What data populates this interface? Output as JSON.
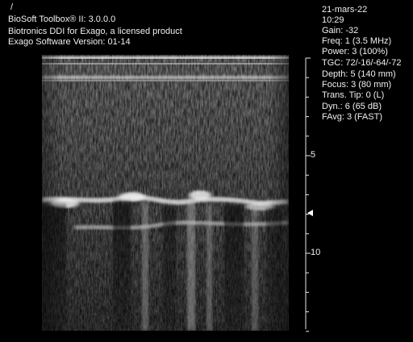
{
  "header": {
    "marker": "/",
    "product": "BioSoft Toolbox® II: 3.0.0.0",
    "license": "Biotronics DDI for Exago, a licensed product",
    "software": "Exago Software Version: 01-14"
  },
  "params": {
    "date": "21-mars-22",
    "time": "10:29",
    "gain": "Gain: -32",
    "freq": "Freq: 1 (3.5 MHz)",
    "power": "Power: 3 (100%)",
    "tgc": "TGC: 72/-16/-64/-72",
    "depth": "Depth: 5 (140 mm)",
    "focus": "Focus: 3 (80 mm)",
    "trans_tip": "Trans. Tip: 0 (L)",
    "dyn": "Dyn.: 6 (65 dB)",
    "favg": "FAvg: 3 (FAST)"
  },
  "depth_scale": {
    "label_5": "5",
    "label_10": "10"
  },
  "colors": {
    "background": "#000000",
    "text": "#f0f0f0"
  }
}
